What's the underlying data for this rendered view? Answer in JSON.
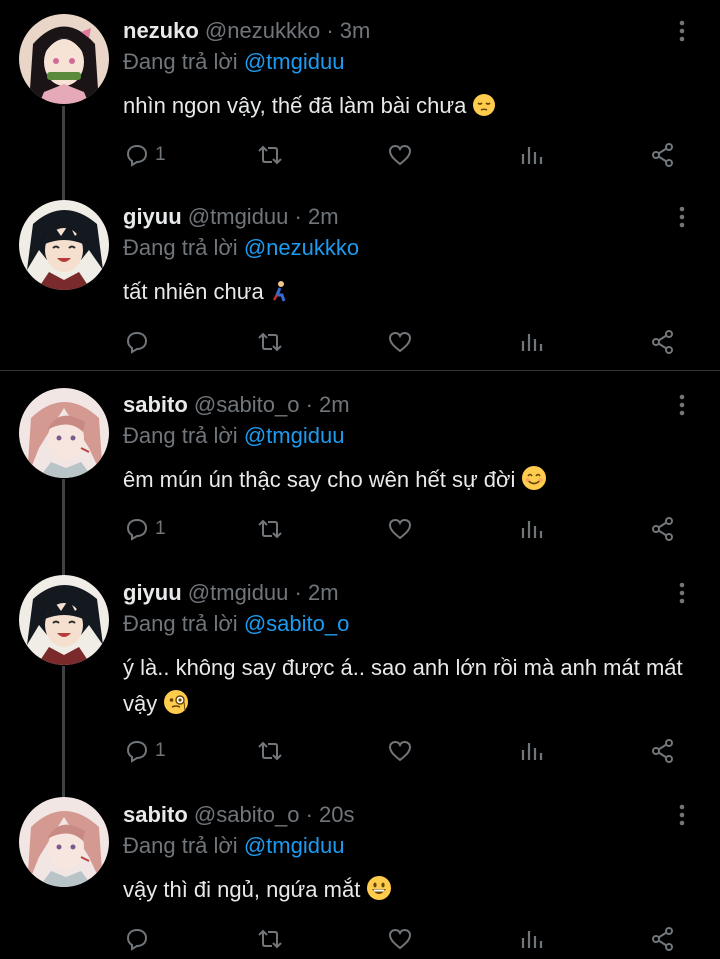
{
  "tweets": [
    {
      "name": "nezuko",
      "handle": "@nezukkko",
      "dot": "·",
      "time": "3m",
      "reply_prefix": "Đang trả lời",
      "reply_to": "@tmgiduu",
      "text": "nhìn ngon vậy, thế đã làm bài chưa",
      "emoji": "pensive-face",
      "reply_count": "1"
    },
    {
      "name": "giyuu",
      "handle": "@tmgiduu",
      "dot": "·",
      "time": "2m",
      "reply_prefix": "Đang trả lời",
      "reply_to": "@nezukkko",
      "text": "tất nhiên chưa",
      "emoji": "person-kneeling",
      "reply_count": ""
    },
    {
      "name": "sabito",
      "handle": "@sabito_o",
      "dot": "·",
      "time": "2m",
      "reply_prefix": "Đang trả lời",
      "reply_to": "@tmgiduu",
      "text": "êm mún ún thậc say cho wên hết sự đời",
      "emoji": "smiling-face",
      "reply_count": "1"
    },
    {
      "name": "giyuu",
      "handle": "@tmgiduu",
      "dot": "·",
      "time": "2m",
      "reply_prefix": "Đang trả lời",
      "reply_to": "@sabito_o",
      "text": "ý là.. không say được á.. sao anh lớn rồi mà anh mát mát vậy",
      "emoji": "face-with-monocle",
      "reply_count": "1"
    },
    {
      "name": "sabito",
      "handle": "@sabito_o",
      "dot": "·",
      "time": "20s",
      "reply_prefix": "Đang trả lời",
      "reply_to": "@tmgiduu",
      "text": "vậy thì đi ngủ, ngứa mắt",
      "emoji": "grinning-face",
      "reply_count": ""
    }
  ],
  "colors": {
    "background": "#000000",
    "text": "#e7e9ea",
    "muted": "#71767b",
    "mention": "#1d9bf0",
    "thread_line": "#3d4247",
    "divider": "#2f3336"
  }
}
